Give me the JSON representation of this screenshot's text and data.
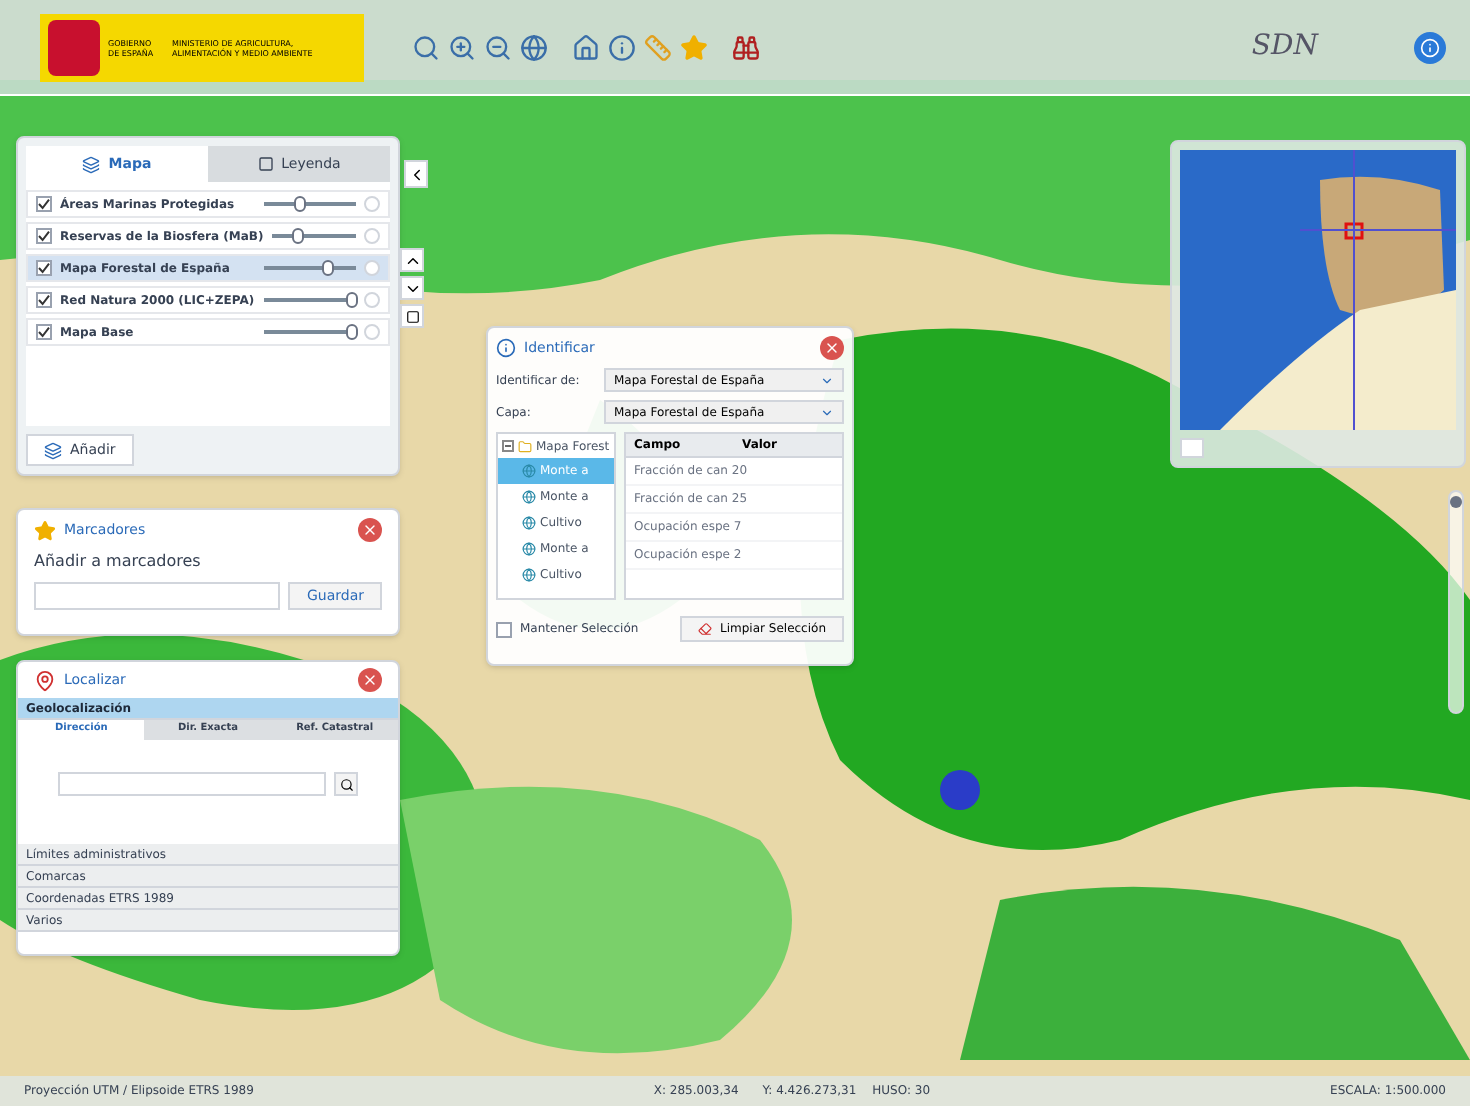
{
  "header": {
    "logo_line_1": "GOBIERNO DE ESPAÑA",
    "logo_line_2": "MINISTERIO DE AGRICULTURA, ALIMENTACIÓN Y MEDIO AMBIENTE",
    "brand": "SDN"
  },
  "layers_panel": {
    "tabs": [
      {
        "label": "Mapa",
        "selected": true
      },
      {
        "label": "Leyenda",
        "selected": false
      }
    ],
    "layers": [
      {
        "name": "Áreas Marinas Protegidas",
        "checked": true,
        "selected": false,
        "level": 0.4
      },
      {
        "name": "Reservas de la Biosfera (MaB)",
        "checked": true,
        "selected": false,
        "level": 0.3
      },
      {
        "name": "Mapa Forestal de España",
        "checked": true,
        "selected": true,
        "level": 0.7
      },
      {
        "name": "Red Natura 2000 (LIC+ZEPA)",
        "checked": true,
        "selected": false,
        "level": 0.95
      },
      {
        "name": "Mapa Base",
        "checked": true,
        "selected": false,
        "level": 0.95
      }
    ],
    "add_button": "Añadir"
  },
  "bookmarks": {
    "title": "Marcadores",
    "label": "Añadir a marcadores",
    "save_button": "Guardar"
  },
  "locate": {
    "title": "Localizar",
    "sections": [
      {
        "label": "Geolocalización",
        "expanded": true
      },
      {
        "label": "Límites administrativos",
        "expanded": false
      },
      {
        "label": "Comarcas",
        "expanded": false
      },
      {
        "label": "Coordenadas ETRS 1989",
        "expanded": false
      },
      {
        "label": "Varios",
        "expanded": false
      }
    ],
    "tabs": [
      {
        "label": "Dirección",
        "selected": true
      },
      {
        "label": "Dir. Exacta",
        "selected": false
      },
      {
        "label": "Ref. Catastral",
        "selected": false
      }
    ]
  },
  "identify": {
    "title": "Identificar",
    "identify_label": "Identificar de:",
    "identify_value": "Mapa Forestal de España",
    "layer_label": "Capa:",
    "layer_value": "Mapa Forestal de España",
    "tree": {
      "label": "Mapa Forest",
      "expanded": true,
      "children": [
        {
          "label": "Monte a",
          "selected": true
        },
        {
          "label": "Monte a",
          "selected": false
        },
        {
          "label": "Cultivo",
          "selected": false
        },
        {
          "label": "Monte a",
          "selected": false
        },
        {
          "label": "Cultivo",
          "selected": false
        }
      ]
    },
    "columns": [
      "Campo",
      "Valor"
    ],
    "rows": [
      {
        "field": "Fracción de can 20"
      },
      {
        "field": "Fracción de can 25"
      },
      {
        "field": "Ocupación espe 7"
      },
      {
        "field": "Ocupación espe 2"
      }
    ],
    "keep_selection": {
      "label": "Mantener Selección",
      "checked": false
    },
    "clear_button": "Limpiar Selección"
  },
  "zoom_slider": {
    "level": 0.02
  },
  "status_bar": {
    "projection": "Proyección UTM / Elipsoide ETRS 1989",
    "x": "X: 285.003,34",
    "y": "Y: 4.426.273,31",
    "zone": "HUSO: 30",
    "scale": "ESCALA: 1:500.000"
  }
}
